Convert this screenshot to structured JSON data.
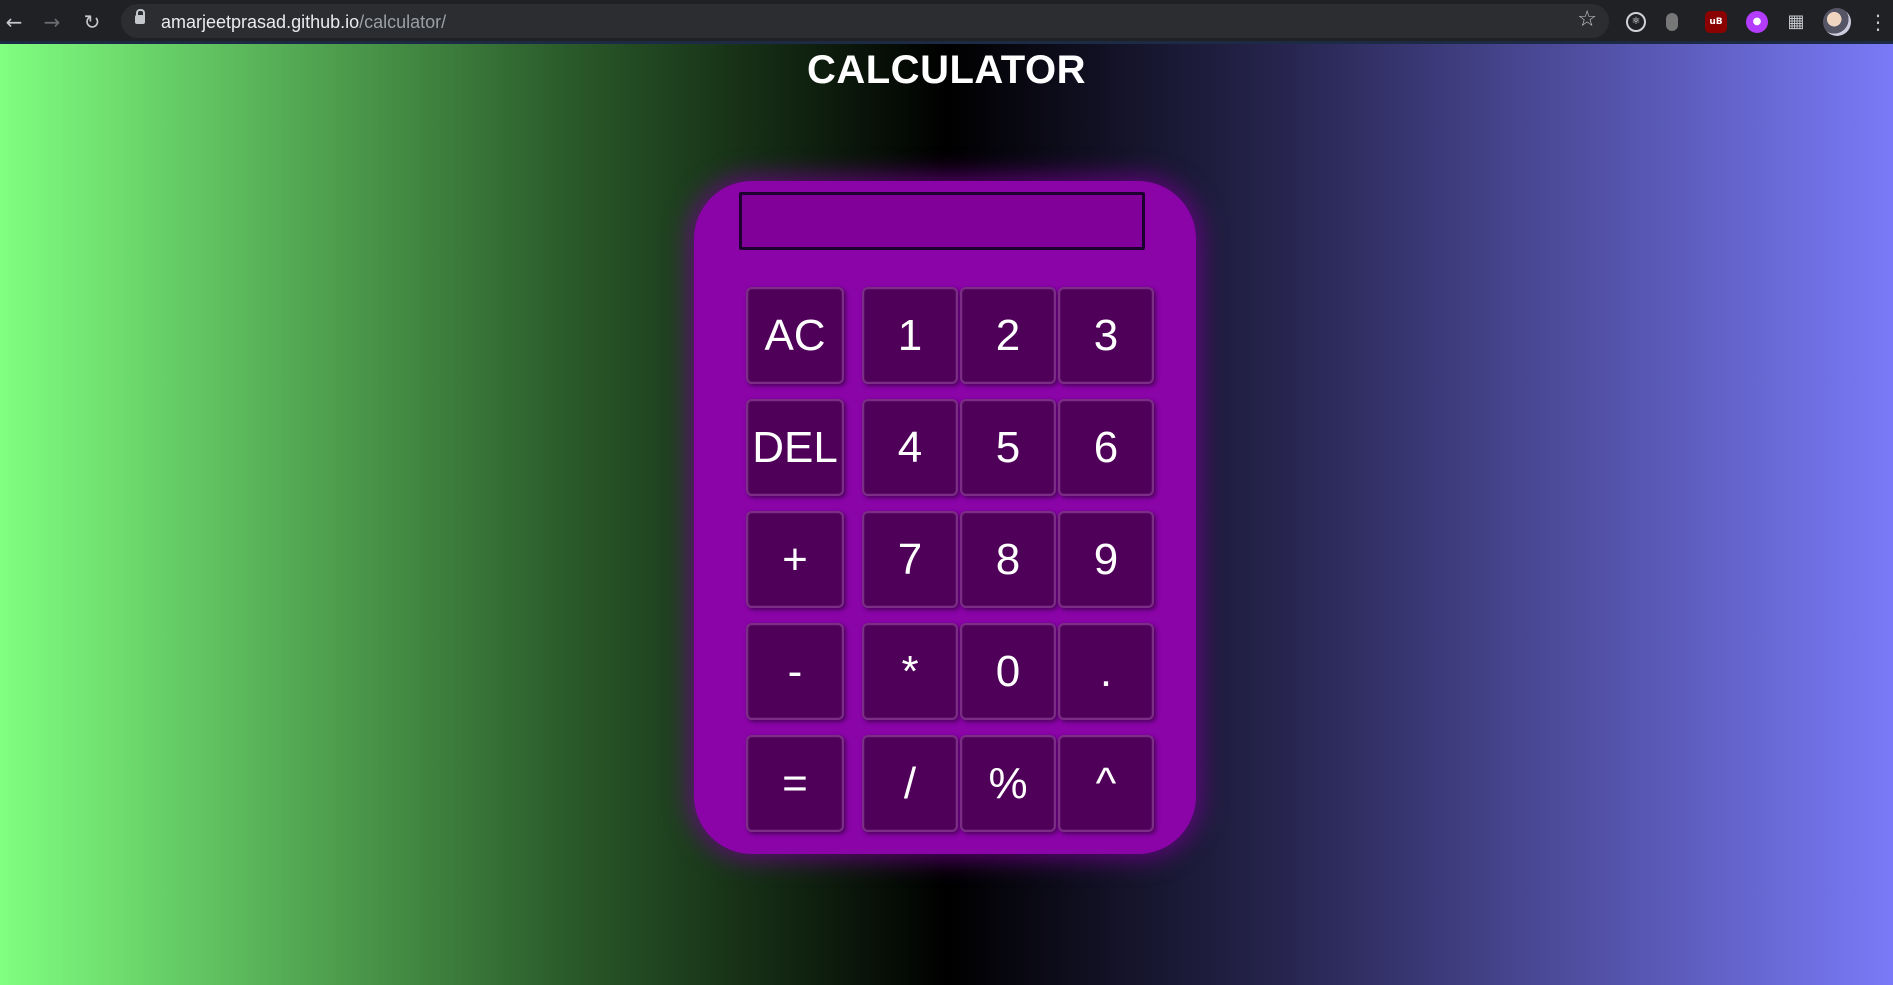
{
  "browser": {
    "url_host": "amarjeetprasad.github.io",
    "url_path": "/calculator/",
    "icons": [
      "back-arrow-icon",
      "forward-arrow-icon",
      "reload-icon",
      "lock-icon",
      "star-icon",
      "react-devtools-icon",
      "mouse-extension-icon",
      "ublock-icon",
      "purple-extension-icon",
      "puzzle-extensions-icon",
      "profile-avatar",
      "kebab-menu-icon"
    ]
  },
  "page": {
    "title": "CALCULATOR",
    "gradient_colors": [
      "#80ff80",
      "#000000",
      "#7a7af8"
    ],
    "accent": "#8a04a8"
  },
  "calculator": {
    "display_value": "",
    "keys": [
      {
        "label": "AC"
      },
      {
        "label": "1"
      },
      {
        "label": "2"
      },
      {
        "label": "3"
      },
      {
        "label": "DEL"
      },
      {
        "label": "4"
      },
      {
        "label": "5"
      },
      {
        "label": "6"
      },
      {
        "label": "+"
      },
      {
        "label": "7"
      },
      {
        "label": "8"
      },
      {
        "label": "9"
      },
      {
        "label": "-"
      },
      {
        "label": "*"
      },
      {
        "label": "0"
      },
      {
        "label": "."
      },
      {
        "label": "="
      },
      {
        "label": "/"
      },
      {
        "label": "%"
      },
      {
        "label": "^"
      }
    ]
  }
}
